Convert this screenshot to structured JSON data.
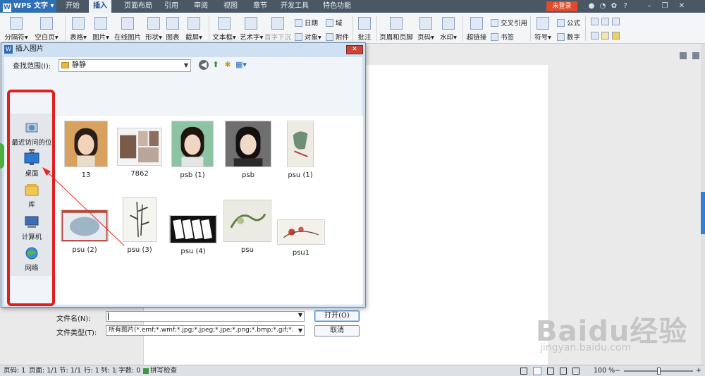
{
  "app": {
    "name": "WPS 文字",
    "logo_letter": "W",
    "menu_tabs": [
      "开始",
      "插入",
      "页面布局",
      "引用",
      "审阅",
      "视图",
      "章节",
      "开发工具",
      "特色功能"
    ],
    "active_tab": "插入",
    "login_label": "未登录",
    "help_label": "?"
  },
  "ribbon": {
    "groups": [
      {
        "label": "分隔符",
        "id": "page-break"
      },
      {
        "label": "空白页",
        "id": "blank-page"
      },
      {
        "label": "表格",
        "id": "table"
      },
      {
        "label": "图片",
        "id": "picture"
      },
      {
        "label": "在线图片",
        "id": "online-picture"
      },
      {
        "label": "形状",
        "id": "shapes"
      },
      {
        "label": "图表",
        "id": "chart"
      },
      {
        "label": "截屏",
        "id": "screenshot"
      },
      {
        "label": "文本框",
        "id": "textbox"
      },
      {
        "label": "艺术字",
        "id": "wordart"
      },
      {
        "label": "首字下沉",
        "id": "dropcap"
      },
      {
        "label": "日期",
        "id": "date"
      },
      {
        "label": "对象",
        "id": "object"
      },
      {
        "label": "域",
        "id": "field"
      },
      {
        "label": "附件",
        "id": "attachment"
      },
      {
        "label": "批注",
        "id": "comment"
      },
      {
        "label": "页眉和页脚",
        "id": "header-footer"
      },
      {
        "label": "页码",
        "id": "page-number"
      },
      {
        "label": "水印",
        "id": "watermark"
      },
      {
        "label": "超链接",
        "id": "hyperlink"
      },
      {
        "label": "交叉引用",
        "id": "cross-reference"
      },
      {
        "label": "书签",
        "id": "bookmark"
      },
      {
        "label": "符号",
        "id": "symbol"
      },
      {
        "label": "公式",
        "id": "equation"
      },
      {
        "label": "数字",
        "id": "number"
      }
    ]
  },
  "dialog": {
    "title": "插入图片",
    "close_glyph": "✕",
    "look_in_label": "查找范围(I):",
    "look_in_value": "静静",
    "places": [
      "最近访问的位置",
      "桌面",
      "库",
      "计算机",
      "网络"
    ],
    "files": [
      "13",
      "7862",
      "psb (1)",
      "psb",
      "psu (1)",
      "psu (2)",
      "psu (3)",
      "psu (4)",
      "psu",
      "psu1"
    ],
    "filename_label": "文件名(N):",
    "filename_value": "",
    "filetype_label": "文件类型(T):",
    "filetype_value": "所有图片(*.emf;*.wmf;*.jpg;*.jpeg;*.jpe;*.png;*.bmp;*.gif;*.",
    "open_label": "打开(O)",
    "cancel_label": "取消"
  },
  "statusbar": {
    "page_num": "页码: 1",
    "pages": "页面: 1/1",
    "section": "节: 1/1",
    "row": "行: 1",
    "col": "列: 1",
    "word_count": "字数: 0",
    "spellcheck": "拼写检查",
    "zoom": "100 %",
    "zoom_out": "−",
    "zoom_in": "+",
    "zoom_level": 0.5
  },
  "watermark": {
    "brand": "Baidu经验",
    "url": "jingyan.baidu.com"
  },
  "colors": {
    "annotation_red": "#e01f1f",
    "ribbon_accent": "#2f6fb5",
    "login_button": "#e04b2b"
  }
}
